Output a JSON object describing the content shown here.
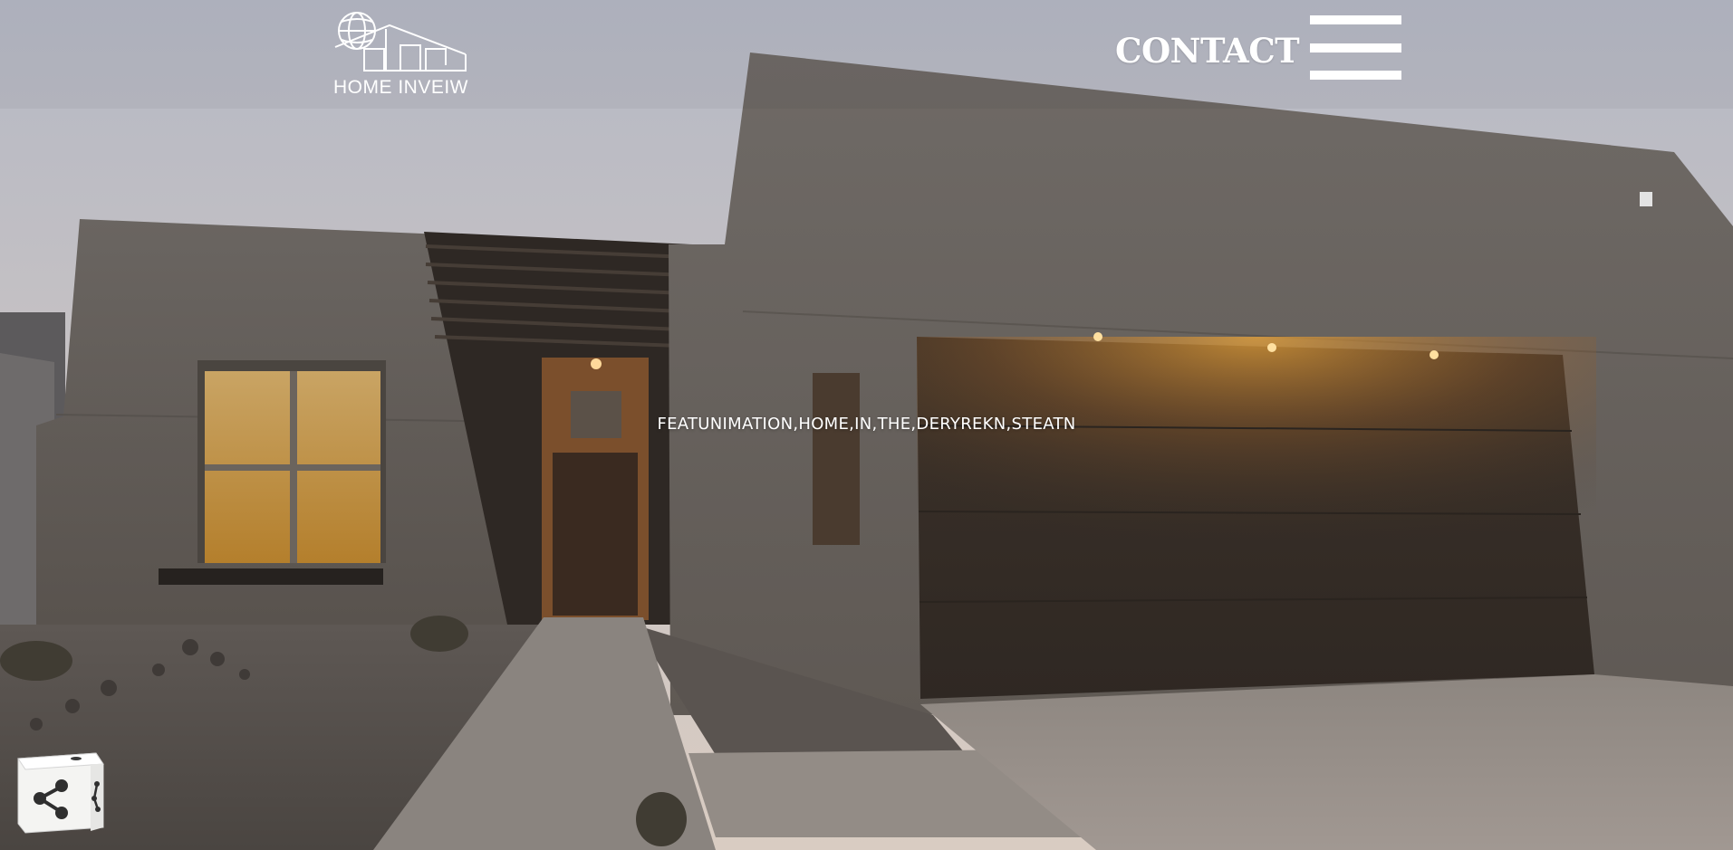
{
  "header": {
    "logo_text": "HOME INVEIW",
    "contact_label": "CONTACT",
    "menu_icon": "hamburger-menu-icon"
  },
  "hero": {
    "caption": "FEATUNIMATION,HOME,IN,THE,DERYREKN,STEATN",
    "background": "modern-stucco-house-at-dusk-photo"
  },
  "share_widget": {
    "icon": "share-icon"
  },
  "colors": {
    "text": "#ffffff",
    "sky_top": "#b9bcc6",
    "sky_bottom": "#d7ccc4",
    "stucco": "#6b6560",
    "garage_door": "#3a2e25",
    "warm_light": "#e0a03a"
  }
}
